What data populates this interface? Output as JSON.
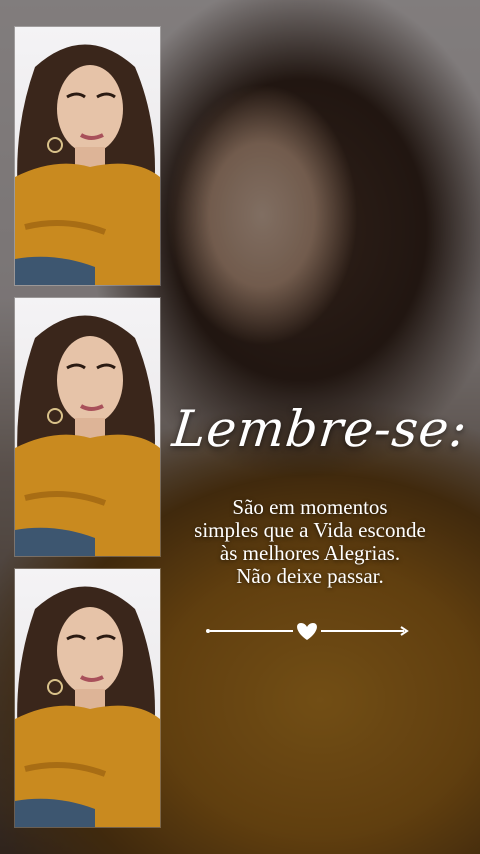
{
  "heading": "Lembre-se:",
  "message": {
    "line1": "São em momentos",
    "line2": "simples que a Vida esconde",
    "line3": "às melhores Alegrias.",
    "line4": "Não deixe passar."
  },
  "divider_icon": "heart-icon",
  "colors": {
    "text": "#ffffff",
    "sweater": "#c98a1f",
    "hair": "#3a261b"
  }
}
